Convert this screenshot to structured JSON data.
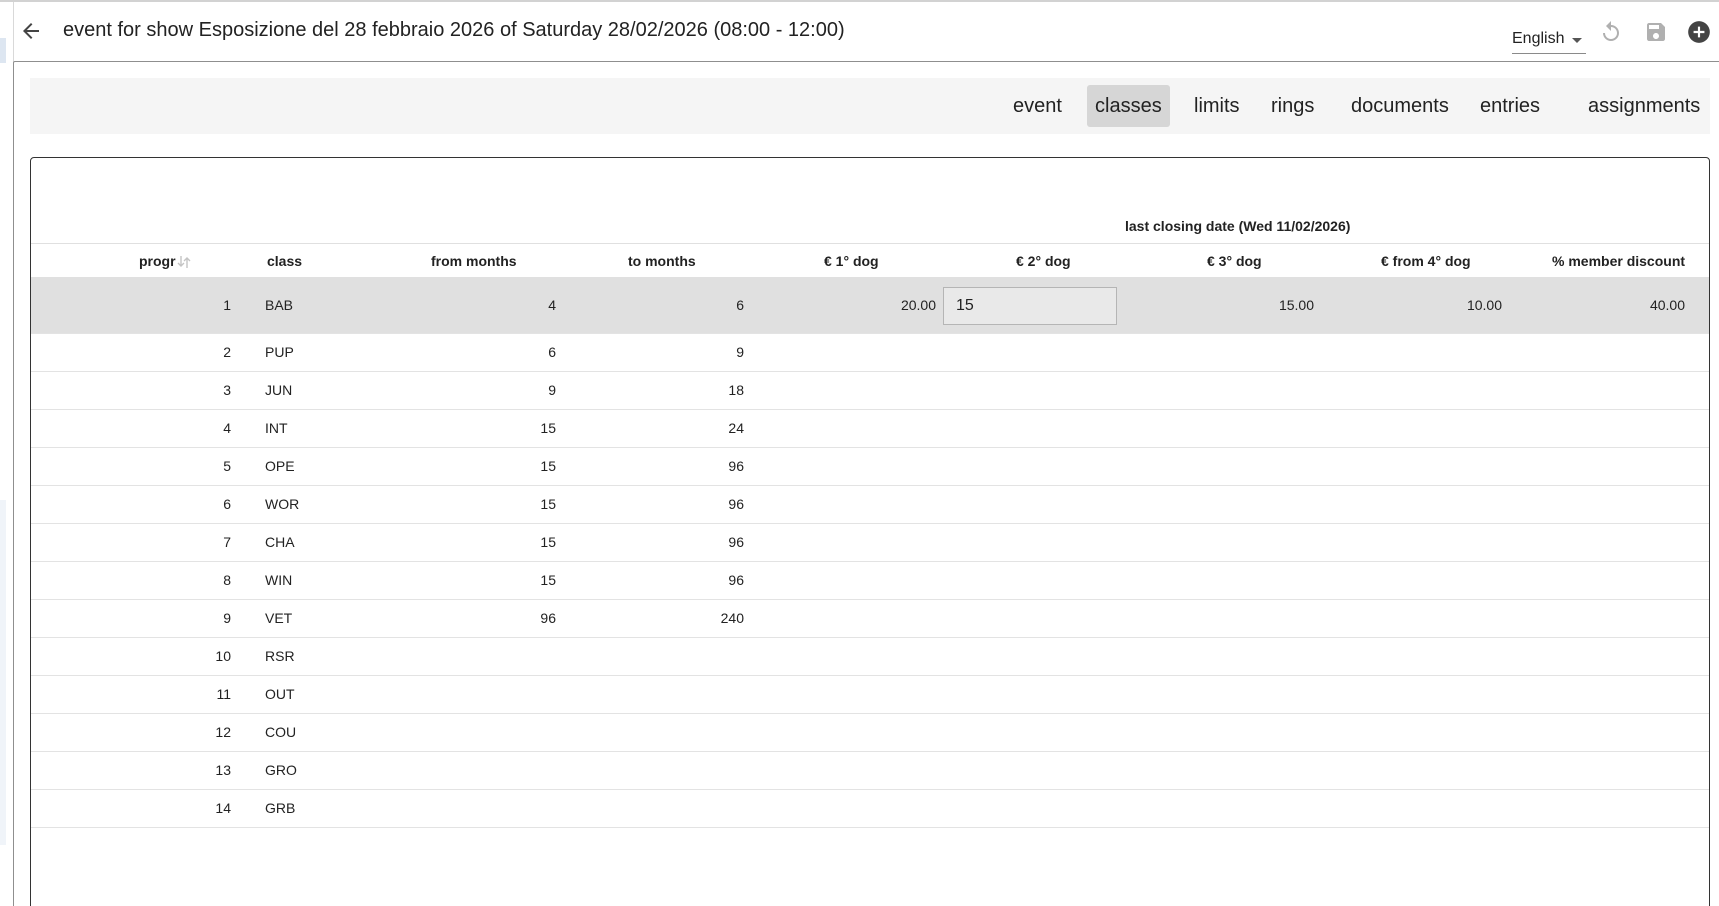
{
  "header": {
    "title": "event for show Esposizione del 28 febbraio 2026 of Saturday 28/02/2026 (08:00 - 12:00)",
    "language": "English"
  },
  "tabs": [
    {
      "label": "event",
      "active": false
    },
    {
      "label": "classes",
      "active": true
    },
    {
      "label": "limits",
      "active": false
    },
    {
      "label": "rings",
      "active": false
    },
    {
      "label": "documents",
      "active": false
    },
    {
      "label": "entries",
      "active": false
    },
    {
      "label": "assignments",
      "active": false
    }
  ],
  "table": {
    "group_label": "last closing date (Wed 11/02/2026)",
    "columns": [
      "progr",
      "class",
      "from months",
      "to months",
      "€ 1° dog",
      "€ 2° dog",
      "€ 3° dog",
      "€ from 4° dog",
      "% member discount"
    ],
    "rows": [
      {
        "progr": "1",
        "class": "BAB",
        "from": "4",
        "to": "6",
        "p1": "20.00",
        "p2": "15",
        "p3": "15.00",
        "p4": "10.00",
        "discount": "40.00"
      },
      {
        "progr": "2",
        "class": "PUP",
        "from": "6",
        "to": "9",
        "p1": "",
        "p2": "",
        "p3": "",
        "p4": "",
        "discount": ""
      },
      {
        "progr": "3",
        "class": "JUN",
        "from": "9",
        "to": "18",
        "p1": "",
        "p2": "",
        "p3": "",
        "p4": "",
        "discount": ""
      },
      {
        "progr": "4",
        "class": "INT",
        "from": "15",
        "to": "24",
        "p1": "",
        "p2": "",
        "p3": "",
        "p4": "",
        "discount": ""
      },
      {
        "progr": "5",
        "class": "OPE",
        "from": "15",
        "to": "96",
        "p1": "",
        "p2": "",
        "p3": "",
        "p4": "",
        "discount": ""
      },
      {
        "progr": "6",
        "class": "WOR",
        "from": "15",
        "to": "96",
        "p1": "",
        "p2": "",
        "p3": "",
        "p4": "",
        "discount": ""
      },
      {
        "progr": "7",
        "class": "CHA",
        "from": "15",
        "to": "96",
        "p1": "",
        "p2": "",
        "p3": "",
        "p4": "",
        "discount": ""
      },
      {
        "progr": "8",
        "class": "WIN",
        "from": "15",
        "to": "96",
        "p1": "",
        "p2": "",
        "p3": "",
        "p4": "",
        "discount": ""
      },
      {
        "progr": "9",
        "class": "VET",
        "from": "96",
        "to": "240",
        "p1": "",
        "p2": "",
        "p3": "",
        "p4": "",
        "discount": ""
      },
      {
        "progr": "10",
        "class": "RSR",
        "from": "",
        "to": "",
        "p1": "",
        "p2": "",
        "p3": "",
        "p4": "",
        "discount": ""
      },
      {
        "progr": "11",
        "class": "OUT",
        "from": "",
        "to": "",
        "p1": "",
        "p2": "",
        "p3": "",
        "p4": "",
        "discount": ""
      },
      {
        "progr": "12",
        "class": "COU",
        "from": "",
        "to": "",
        "p1": "",
        "p2": "",
        "p3": "",
        "p4": "",
        "discount": ""
      },
      {
        "progr": "13",
        "class": "GRO",
        "from": "",
        "to": "",
        "p1": "",
        "p2": "",
        "p3": "",
        "p4": "",
        "discount": ""
      },
      {
        "progr": "14",
        "class": "GRB",
        "from": "",
        "to": "",
        "p1": "",
        "p2": "",
        "p3": "",
        "p4": "",
        "discount": ""
      }
    ]
  },
  "icons": {
    "back": "arrow-back-icon",
    "undo": "undo-icon",
    "save": "save-icon",
    "add": "add-circle-icon",
    "sort": "sort-icon"
  },
  "colors": {
    "selected_row": "#e0e0e0",
    "active_tab": "#d6d6d6",
    "tabbar_bg": "#f5f5f5",
    "disabled_icon": "#b0b0b0"
  }
}
